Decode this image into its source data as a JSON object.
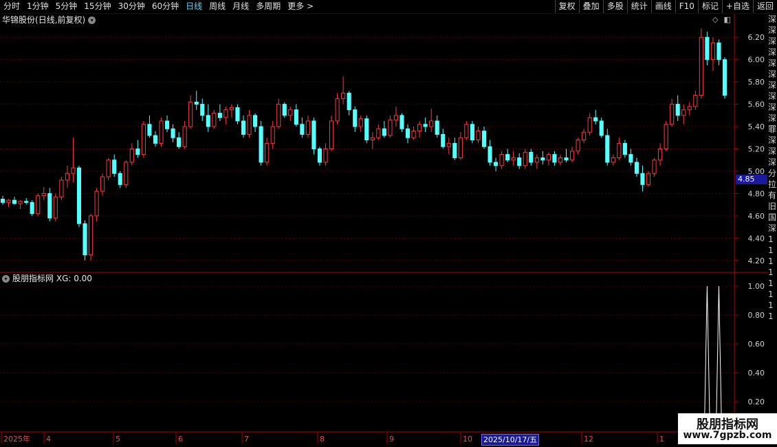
{
  "toolbar": {
    "periods": [
      "分时",
      "1分钟",
      "5分钟",
      "15分钟",
      "30分钟",
      "60分钟",
      "日线",
      "周线",
      "月线",
      "多周期",
      "更多 >"
    ],
    "active_period": "日线",
    "buttons": [
      "复权",
      "叠加",
      "多股",
      "统计",
      "画线",
      "F10",
      "标记",
      "+自选",
      "返回"
    ]
  },
  "main_chart": {
    "stock_name": "华锦股份",
    "mode_label": "(日线,前复权)",
    "price_ticks": [
      "6.20",
      "6.00",
      "5.80",
      "5.60",
      "5.40",
      "5.20",
      "5.00",
      "4.80",
      "4.60",
      "4.40",
      "4.20"
    ],
    "current_price_badge": "4.85",
    "colors": {
      "up": "#ff3b3b",
      "down": "#54ffff",
      "grid": "#5a0000",
      "axis": "#b00000"
    }
  },
  "indicator": {
    "label": "股朋指标网",
    "value_label": "XG: 0.00",
    "ticks": [
      "1.00",
      "0.80",
      "0.60",
      "0.40",
      "0.20"
    ]
  },
  "x_axis": {
    "labels": [
      "2025年",
      "4",
      "5",
      "6",
      "7",
      "8",
      "9",
      "10",
      "12",
      "1"
    ],
    "selected_date": "2025/10/17/五"
  },
  "watermark": {
    "title": "股朋指标网",
    "url": "www.7gpzb.com"
  },
  "right_strip_chars": [
    "深",
    "深",
    "深",
    "深",
    "深",
    "深",
    "深",
    "深",
    "深",
    "深",
    "罪",
    "深",
    "深",
    "深",
    "分",
    "拉",
    "有",
    "旧",
    "国",
    "深",
    "1",
    "1",
    "1",
    "1",
    "1",
    "1",
    "1",
    "1"
  ],
  "chart_data": {
    "type": "candlestick",
    "y_range": [
      4.1,
      6.3
    ],
    "candles_ohlc": [
      [
        4.75,
        4.78,
        4.7,
        4.72
      ],
      [
        4.72,
        4.75,
        4.68,
        4.74
      ],
      [
        4.74,
        4.77,
        4.7,
        4.71
      ],
      [
        4.71,
        4.74,
        4.66,
        4.73
      ],
      [
        4.73,
        4.76,
        4.7,
        4.72
      ],
      [
        4.72,
        4.74,
        4.6,
        4.62
      ],
      [
        4.62,
        4.8,
        4.6,
        4.78
      ],
      [
        4.78,
        4.86,
        4.74,
        4.8
      ],
      [
        4.8,
        4.85,
        4.55,
        4.58
      ],
      [
        4.58,
        4.8,
        4.55,
        4.77
      ],
      [
        4.77,
        4.95,
        4.74,
        4.92
      ],
      [
        4.92,
        5.05,
        4.85,
        4.98
      ],
      [
        4.98,
        5.3,
        4.9,
        5.03
      ],
      [
        5.03,
        5.05,
        4.5,
        4.53
      ],
      [
        4.53,
        4.56,
        4.2,
        4.25
      ],
      [
        4.25,
        4.62,
        4.2,
        4.6
      ],
      [
        4.6,
        4.85,
        4.55,
        4.82
      ],
      [
        4.82,
        4.98,
        4.78,
        4.95
      ],
      [
        4.95,
        5.12,
        4.92,
        5.1
      ],
      [
        5.1,
        5.15,
        4.95,
        4.98
      ],
      [
        4.98,
        5.0,
        4.85,
        4.88
      ],
      [
        4.88,
        5.1,
        4.85,
        5.08
      ],
      [
        5.08,
        5.25,
        5.05,
        5.2
      ],
      [
        5.2,
        5.28,
        5.12,
        5.15
      ],
      [
        5.15,
        5.45,
        5.12,
        5.42
      ],
      [
        5.42,
        5.5,
        5.3,
        5.32
      ],
      [
        5.32,
        5.36,
        5.22,
        5.25
      ],
      [
        5.25,
        5.48,
        5.22,
        5.45
      ],
      [
        5.45,
        5.5,
        5.35,
        5.38
      ],
      [
        5.38,
        5.42,
        5.26,
        5.3
      ],
      [
        5.3,
        5.35,
        5.2,
        5.22
      ],
      [
        5.22,
        5.45,
        5.2,
        5.4
      ],
      [
        5.4,
        5.68,
        5.38,
        5.62
      ],
      [
        5.62,
        5.72,
        5.55,
        5.6
      ],
      [
        5.6,
        5.65,
        5.45,
        5.5
      ],
      [
        5.5,
        5.6,
        5.35,
        5.4
      ],
      [
        5.4,
        5.55,
        5.38,
        5.52
      ],
      [
        5.52,
        5.6,
        5.45,
        5.48
      ],
      [
        5.48,
        5.58,
        5.42,
        5.55
      ],
      [
        5.55,
        5.6,
        5.48,
        5.57
      ],
      [
        5.57,
        5.6,
        5.42,
        5.45
      ],
      [
        5.45,
        5.5,
        5.3,
        5.33
      ],
      [
        5.33,
        5.55,
        5.3,
        5.5
      ],
      [
        5.5,
        5.52,
        5.35,
        5.4
      ],
      [
        5.4,
        5.45,
        5.05,
        5.08
      ],
      [
        5.08,
        5.3,
        5.05,
        5.25
      ],
      [
        5.25,
        5.45,
        5.2,
        5.4
      ],
      [
        5.4,
        5.65,
        5.38,
        5.6
      ],
      [
        5.6,
        5.62,
        5.48,
        5.5
      ],
      [
        5.5,
        5.58,
        5.45,
        5.55
      ],
      [
        5.55,
        5.6,
        5.4,
        5.42
      ],
      [
        5.42,
        5.48,
        5.3,
        5.33
      ],
      [
        5.33,
        5.5,
        5.3,
        5.45
      ],
      [
        5.45,
        5.48,
        5.15,
        5.2
      ],
      [
        5.2,
        5.22,
        5.05,
        5.08
      ],
      [
        5.08,
        5.25,
        5.05,
        5.2
      ],
      [
        5.2,
        5.5,
        5.18,
        5.45
      ],
      [
        5.45,
        5.7,
        5.42,
        5.65
      ],
      [
        5.65,
        5.85,
        5.6,
        5.7
      ],
      [
        5.7,
        5.72,
        5.5,
        5.55
      ],
      [
        5.55,
        5.58,
        5.35,
        5.4
      ],
      [
        5.4,
        5.5,
        5.35,
        5.47
      ],
      [
        5.47,
        5.5,
        5.25,
        5.28
      ],
      [
        5.28,
        5.35,
        5.2,
        5.3
      ],
      [
        5.3,
        5.42,
        5.28,
        5.38
      ],
      [
        5.38,
        5.45,
        5.3,
        5.32
      ],
      [
        5.32,
        5.5,
        5.3,
        5.46
      ],
      [
        5.46,
        5.58,
        5.4,
        5.5
      ],
      [
        5.5,
        5.52,
        5.35,
        5.38
      ],
      [
        5.38,
        5.42,
        5.25,
        5.3
      ],
      [
        5.3,
        5.4,
        5.28,
        5.36
      ],
      [
        5.36,
        5.45,
        5.3,
        5.42
      ],
      [
        5.42,
        5.48,
        5.35,
        5.4
      ],
      [
        5.4,
        5.56,
        5.35,
        5.45
      ],
      [
        5.45,
        5.5,
        5.3,
        5.33
      ],
      [
        5.33,
        5.38,
        5.2,
        5.22
      ],
      [
        5.22,
        5.3,
        5.15,
        5.25
      ],
      [
        5.25,
        5.3,
        5.1,
        5.12
      ],
      [
        5.12,
        5.35,
        5.1,
        5.3
      ],
      [
        5.3,
        5.45,
        5.28,
        5.42
      ],
      [
        5.42,
        5.45,
        5.25,
        5.28
      ],
      [
        5.28,
        5.4,
        5.25,
        5.36
      ],
      [
        5.36,
        5.4,
        5.2,
        5.22
      ],
      [
        5.22,
        5.28,
        5.05,
        5.08
      ],
      [
        5.08,
        5.12,
        5.0,
        5.05
      ],
      [
        5.05,
        5.18,
        5.02,
        5.15
      ],
      [
        5.15,
        5.2,
        5.08,
        5.1
      ],
      [
        5.1,
        5.18,
        5.05,
        5.12
      ],
      [
        5.12,
        5.16,
        5.02,
        5.05
      ],
      [
        5.05,
        5.2,
        5.02,
        5.17
      ],
      [
        5.17,
        5.2,
        5.05,
        5.08
      ],
      [
        5.08,
        5.15,
        5.02,
        5.12
      ],
      [
        5.12,
        5.18,
        5.06,
        5.1
      ],
      [
        5.1,
        5.17,
        5.05,
        5.15
      ],
      [
        5.15,
        5.18,
        5.05,
        5.08
      ],
      [
        5.08,
        5.15,
        5.05,
        5.12
      ],
      [
        5.12,
        5.2,
        5.08,
        5.1
      ],
      [
        5.1,
        5.22,
        5.08,
        5.18
      ],
      [
        5.18,
        5.3,
        5.15,
        5.28
      ],
      [
        5.28,
        5.38,
        5.25,
        5.35
      ],
      [
        5.35,
        5.52,
        5.32,
        5.48
      ],
      [
        5.48,
        5.55,
        5.42,
        5.45
      ],
      [
        5.45,
        5.48,
        5.3,
        5.32
      ],
      [
        5.32,
        5.38,
        5.05,
        5.08
      ],
      [
        5.08,
        5.15,
        5.05,
        5.12
      ],
      [
        5.12,
        5.3,
        5.1,
        5.25
      ],
      [
        5.25,
        5.28,
        5.12,
        5.15
      ],
      [
        5.15,
        5.2,
        5.05,
        5.08
      ],
      [
        5.08,
        5.12,
        4.95,
        4.98
      ],
      [
        4.98,
        5.05,
        4.82,
        4.88
      ],
      [
        4.88,
        5.0,
        4.86,
        4.98
      ],
      [
        4.98,
        5.12,
        4.95,
        5.1
      ],
      [
        5.1,
        5.25,
        5.05,
        5.2
      ],
      [
        5.2,
        5.45,
        5.18,
        5.42
      ],
      [
        5.42,
        5.65,
        5.4,
        5.6
      ],
      [
        5.6,
        5.68,
        5.45,
        5.5
      ],
      [
        5.5,
        5.6,
        5.42,
        5.55
      ],
      [
        5.55,
        5.62,
        5.5,
        5.58
      ],
      [
        5.58,
        5.72,
        5.55,
        5.68
      ],
      [
        5.68,
        6.28,
        5.65,
        6.2
      ],
      [
        6.2,
        6.25,
        5.95,
        6.0
      ],
      [
        6.0,
        6.2,
        5.9,
        6.15
      ],
      [
        6.15,
        6.18,
        5.95,
        6.0
      ],
      [
        6.0,
        6.02,
        5.65,
        5.68
      ]
    ],
    "indicator_values": [
      1,
      1
    ]
  }
}
